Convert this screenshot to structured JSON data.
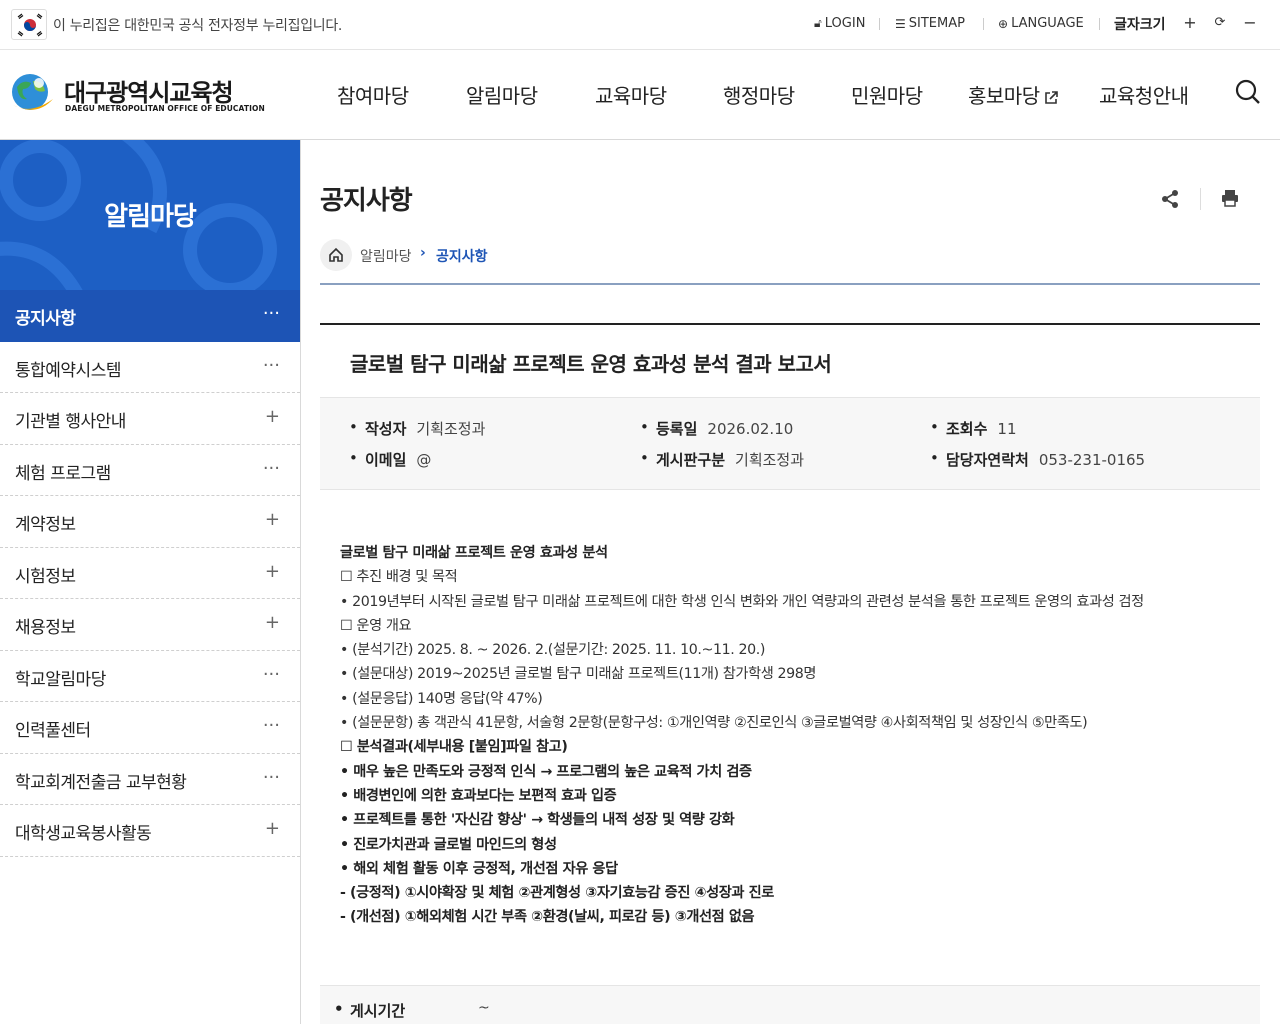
{
  "gov_banner": {
    "text": "이 누리집은 대한민국 공식 전자정부 누리집입니다."
  },
  "utility": {
    "login": "LOGIN",
    "sitemap": "SITEMAP",
    "language": "LANGUAGE",
    "font_size_label": "글자크기",
    "font_plus": "+",
    "font_reset": "⟳",
    "font_minus": "−"
  },
  "logo": {
    "name_kr": "대구광역시교육청",
    "name_en": "DAEGU METROPOLITAN OFFICE OF EDUCATION"
  },
  "gnb": [
    "참여마당",
    "알림마당",
    "교육마당",
    "행정마당",
    "민원마당",
    "홍보마당",
    "교육청안내"
  ],
  "sidebar": {
    "title": "알림마당",
    "items": [
      {
        "label": "공지사항",
        "mark": "···",
        "active": true
      },
      {
        "label": "통합예약시스템",
        "mark": "···"
      },
      {
        "label": "기관별 행사안내",
        "mark": "+"
      },
      {
        "label": "체험 프로그램",
        "mark": "···"
      },
      {
        "label": "계약정보",
        "mark": "+"
      },
      {
        "label": "시험정보",
        "mark": "+"
      },
      {
        "label": "채용정보",
        "mark": "+"
      },
      {
        "label": "학교알림마당",
        "mark": "···"
      },
      {
        "label": "인력풀센터",
        "mark": "···"
      },
      {
        "label": "학교회계전출금 교부현황",
        "mark": "···"
      },
      {
        "label": "대학생교육봉사활동",
        "mark": "+"
      }
    ]
  },
  "page": {
    "title": "공지사항",
    "breadcrumb": [
      "알림마당",
      "공지사항"
    ],
    "breadcrumb_sep": "›"
  },
  "article": {
    "title": "글로벌 탐구 미래삶 프로젝트 운영 효과성 분석 결과 보고서",
    "meta": {
      "author_label": "작성자",
      "author": "기획조정과",
      "date_label": "등록일",
      "date": "2026.02.10",
      "views_label": "조회수",
      "views": "11",
      "email_label": "이메일",
      "email": "@",
      "category_label": "게시판구분",
      "category": "기획조정과",
      "contact_label": "담당자연락처",
      "contact": "053-231-0165"
    },
    "body": [
      "글로벌 탐구 미래삶 프로젝트 운영 효과성 분석",
      "☐ 추진 배경 및 목적",
      " • 2019년부터 시작된 글로벌 탐구 미래삶 프로젝트에 대한 학생 인식 변화와 개인 역량과의 관련성 분석을 통한 프로젝트 운영의 효과성 검정",
      "☐ 운영 개요",
      " • (분석기간) 2025. 8. ~ 2026. 2.(설문기간: 2025. 11. 10.~11. 20.)",
      " • (설문대상) 2019~2025년 글로벌 탐구 미래삶 프로젝트(11개) 참가학생 298명",
      " • (설문응답) 140명 응답(약 47%)",
      " • (설문문항) 총 객관식 41문항, 서술형 2문항(문항구성: ①개인역량 ②진로인식 ③글로벌역량 ④사회적책임 및 성장인식 ⑤만족도)",
      "☐ 분석결과(세부내용 [붙임]파일 참고)",
      " • 매우 높은 만족도와 긍정적 인식 → 프로그램의 높은 교육적 가치 검증",
      " • 배경변인에 의한 효과보다는 보편적 효과 입증",
      " • 프로젝트를 통한 '자신감 향상' → 학생들의 내적 성장 및 역량 강화",
      " • 진로가치관과 글로벌 마인드의 형성",
      " • 해외 체험 활동 이후 긍정적, 개선점 자유 응답",
      "- (긍정적) ①시야확장 및 체험 ②관계형성 ③자기효능감 증진 ④성장과 진로",
      "- (개선점) ①해외체험 시간 부족 ②환경(날씨, 피로감 등) ③개선점 없음"
    ],
    "period_label": "게시기간",
    "period_value": "~"
  },
  "colors": {
    "primary": "#1d54b5",
    "banner": "#1d5fc4"
  }
}
